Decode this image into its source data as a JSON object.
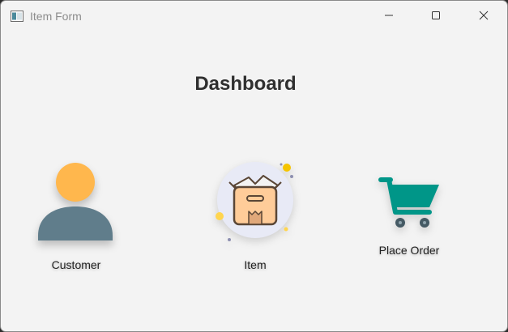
{
  "window": {
    "title": "Item Form",
    "controls": {
      "minimize_icon": "minimize-icon",
      "maximize_icon": "maximize-icon",
      "close_icon": "close-icon"
    }
  },
  "dashboard": {
    "title": "Dashboard",
    "tiles": [
      {
        "label": "Customer",
        "icon": "customer-icon"
      },
      {
        "label": "Item",
        "icon": "item-box-icon"
      },
      {
        "label": "Place Order",
        "icon": "shopping-cart-icon"
      }
    ]
  },
  "colors": {
    "window_bg": "#f3f3f3",
    "customer_head": "#ffb74d",
    "customer_body": "#607d8b",
    "cart": "#009688",
    "item_circle": "#e8eaf6",
    "item_box": "#ffcc99"
  }
}
